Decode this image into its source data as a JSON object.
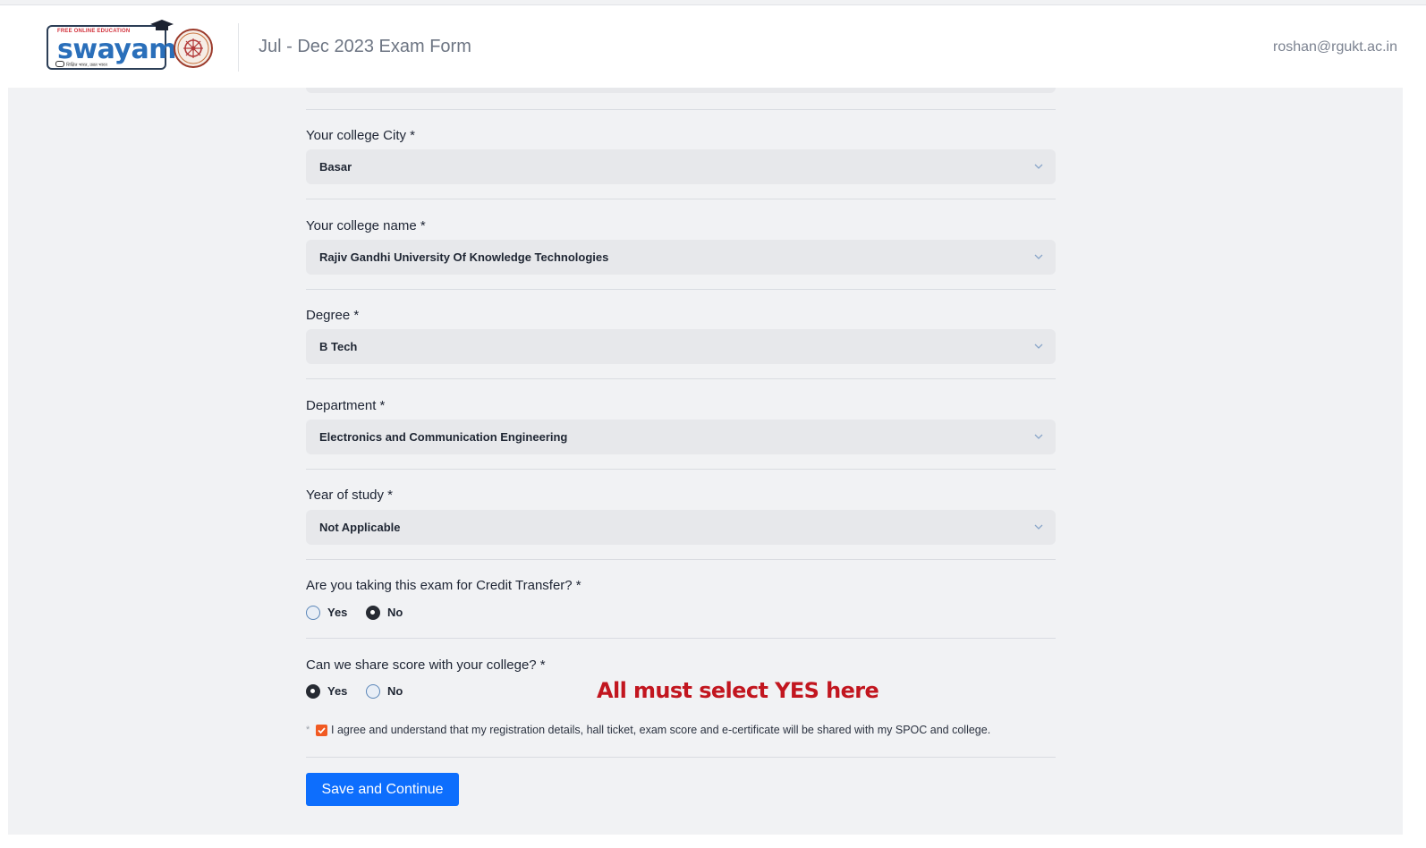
{
  "header": {
    "logo_tagline": "FREE ONLINE EDUCATION",
    "logo_word": "swayam",
    "logo_subtext": "शिक्षित भारत, उन्नत भारत",
    "exam_title": "Jul - Dec 2023 Exam Form",
    "user_email": "roshan@rgukt.ac.in"
  },
  "form": {
    "fields": [
      {
        "label": "Your college City *",
        "value": "Basar"
      },
      {
        "label": "Your college name *",
        "value": "Rajiv Gandhi University Of Knowledge Technologies"
      },
      {
        "label": "Degree *",
        "value": "B Tech"
      },
      {
        "label": "Department *",
        "value": "Electronics and Communication Engineering"
      },
      {
        "label": "Year of study *",
        "value": "Not Applicable"
      }
    ],
    "credit_transfer": {
      "question": "Are you taking this exam for Credit Transfer? *",
      "options": [
        "Yes",
        "No"
      ],
      "selected": "No"
    },
    "share_score": {
      "question": "Can we share score with your college? *",
      "options": [
        "Yes",
        "No"
      ],
      "selected": "Yes"
    },
    "annotation": "All must select YES here",
    "agreement": {
      "required_mark": "*",
      "checked": true,
      "text": "I agree and understand that my registration details, hall ticket, exam score and e-certificate will be shared with my SPOC and college."
    },
    "submit_label": "Save and Continue"
  },
  "colors": {
    "primary_button": "#0d6efd",
    "checkbox": "#f15a22",
    "annotation": "#c2161f",
    "background": "#f1f2f4"
  }
}
